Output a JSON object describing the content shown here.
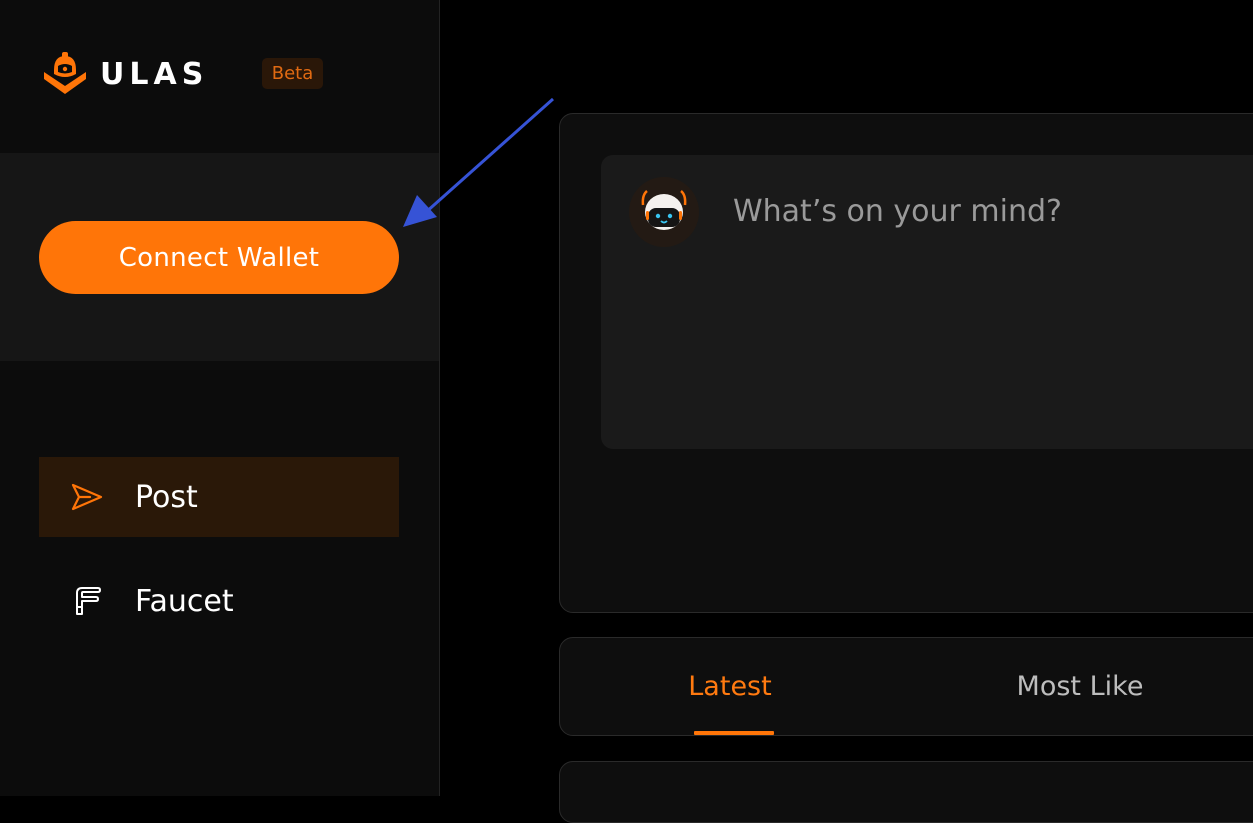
{
  "brand": {
    "name": "ULAS",
    "badge": "Beta",
    "accent": "#ff7508"
  },
  "sidebar": {
    "connect_button": "Connect Wallet",
    "nav": [
      {
        "label": "Post",
        "icon": "send-icon",
        "active": true
      },
      {
        "label": "Faucet",
        "icon": "faucet-icon",
        "active": false
      }
    ]
  },
  "composer": {
    "placeholder": "What’s on your mind?",
    "avatar_icon": "robot-avatar-icon"
  },
  "feed_tabs": [
    {
      "label": "Latest",
      "active": true
    },
    {
      "label": "Most Like",
      "active": false
    }
  ],
  "annotation": {
    "arrow_color": "#3653d6"
  }
}
